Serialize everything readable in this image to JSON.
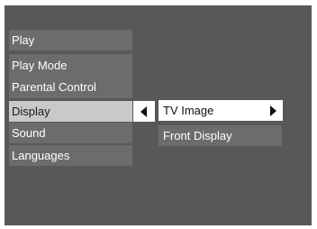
{
  "main_menu": {
    "items": [
      {
        "label": "Play"
      },
      {
        "label": "Play Mode"
      },
      {
        "label": "Parental Control"
      },
      {
        "label": "Display"
      },
      {
        "label": "Sound"
      },
      {
        "label": "Languages"
      }
    ],
    "selected": "Display"
  },
  "sub_menu": {
    "items": [
      {
        "label": "TV Image"
      },
      {
        "label": "Front Display"
      }
    ],
    "selected": "TV Image"
  },
  "icons": {
    "left_arrow": "left-triangle-arrow",
    "right_arrow": "right-triangle-arrow"
  },
  "colors": {
    "background": "#58585a",
    "menu_item": "#6c6c6e",
    "main_selected": "#c9c9cb",
    "sub_selected": "#ffffff",
    "text_light": "#ffffff",
    "text_dark": "#111111"
  }
}
